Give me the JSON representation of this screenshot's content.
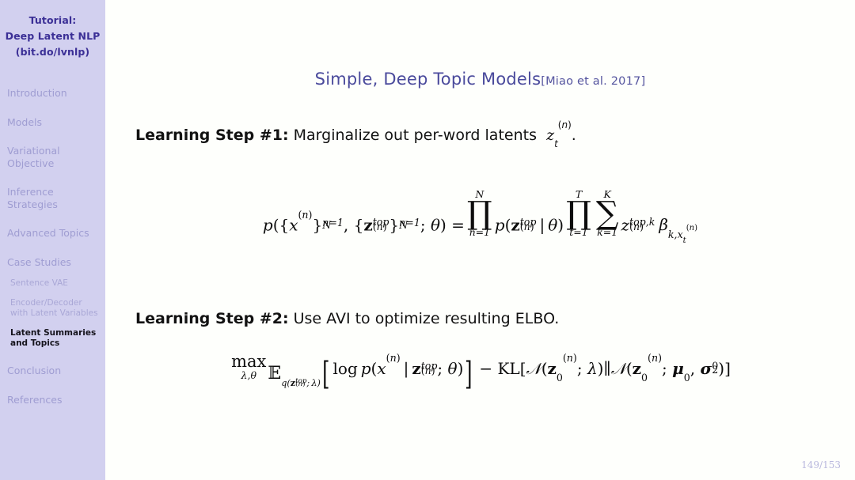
{
  "sidebar": {
    "title_lines": [
      "Tutorial:",
      "Deep Latent NLP",
      "(bit.do/lvnlp)"
    ],
    "items": [
      {
        "label": "Introduction",
        "type": "section",
        "active": false
      },
      {
        "label": "Models",
        "type": "section",
        "active": false
      },
      {
        "label": "Variational Objective",
        "type": "section",
        "active": false
      },
      {
        "label": "Inference Strategies",
        "type": "section",
        "active": false
      },
      {
        "label": "Advanced Topics",
        "type": "section",
        "active": false
      },
      {
        "label": "Case Studies",
        "type": "section",
        "active": false
      }
    ],
    "subitems": [
      {
        "label": "Sentence VAE",
        "active": false
      },
      {
        "label": "Encoder/Decoder with Latent Variables",
        "active": false
      },
      {
        "label": "Latent Summaries and Topics",
        "active": true
      }
    ],
    "tail_items": [
      {
        "label": "Conclusion",
        "type": "section",
        "active": false
      },
      {
        "label": "References",
        "type": "section",
        "active": false
      }
    ],
    "colors": {
      "background": "#d2d0ef",
      "title_text": "#3b2f96",
      "item_text": "#9f9dd2",
      "active_text": "#15131c"
    }
  },
  "main": {
    "title": "Simple, Deep Topic Models",
    "title_citation": "[Miao et al. 2017]",
    "title_color": "#4a4a9c",
    "step1": {
      "label": "Learning Step #1:",
      "text": "Marginalize out per-word latents",
      "math_tail": "z_t^{(n)}.",
      "equation_latex": "p(\\{x^{(n)}\\}_{n=1}^{N}, \\{\\mathbf{z}_{top}^{(n)}\\}_{n=1}^{N}; \\theta) = \\prod_{n=1}^{N} p(\\mathbf{z}_{top}^{(n)} \\mid \\theta) \\prod_{t=1}^{T} \\sum_{k=1}^{K} z_{top,k}^{(n)} \\beta_{k,x_t^{(n)}}"
    },
    "step2": {
      "label": "Learning Step #2:",
      "text": "Use AVI to optimize resulting ELBO.",
      "equation_latex": "\\max_{\\lambda,\\theta} \\mathbb{E}_{q(\\mathbf{z}_{top}^{(n)};\\lambda)} \\left[ \\log p(x^{(n)} \\mid \\mathbf{z}_{top}^{(n)}; \\theta) \\right] - \\mathrm{KL}[\\mathcal{N}(\\mathbf{z}_0^{(n)}; \\lambda) \\| \\mathcal{N}(\\mathbf{z}_0^{(n)}; \\boldsymbol{\\mu}_0, \\boldsymbol{\\sigma}_0^2)]"
    }
  },
  "footer": {
    "page_number": "149/153",
    "color": "#b8b7dd"
  }
}
